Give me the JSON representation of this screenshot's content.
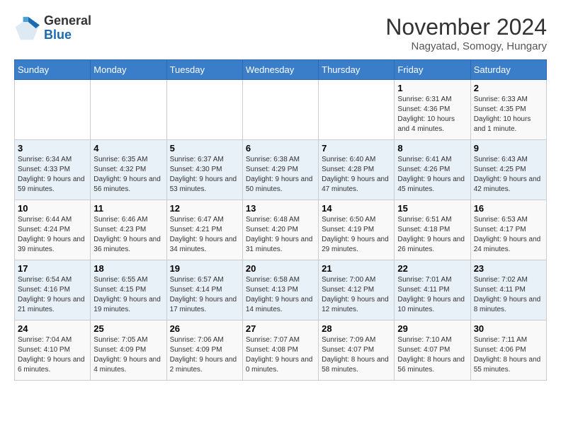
{
  "header": {
    "logo_general": "General",
    "logo_blue": "Blue",
    "month_title": "November 2024",
    "subtitle": "Nagyatad, Somogy, Hungary"
  },
  "weekdays": [
    "Sunday",
    "Monday",
    "Tuesday",
    "Wednesday",
    "Thursday",
    "Friday",
    "Saturday"
  ],
  "weeks": [
    [
      {
        "day": "",
        "info": ""
      },
      {
        "day": "",
        "info": ""
      },
      {
        "day": "",
        "info": ""
      },
      {
        "day": "",
        "info": ""
      },
      {
        "day": "",
        "info": ""
      },
      {
        "day": "1",
        "info": "Sunrise: 6:31 AM\nSunset: 4:36 PM\nDaylight: 10 hours and 4 minutes."
      },
      {
        "day": "2",
        "info": "Sunrise: 6:33 AM\nSunset: 4:35 PM\nDaylight: 10 hours and 1 minute."
      }
    ],
    [
      {
        "day": "3",
        "info": "Sunrise: 6:34 AM\nSunset: 4:33 PM\nDaylight: 9 hours and 59 minutes."
      },
      {
        "day": "4",
        "info": "Sunrise: 6:35 AM\nSunset: 4:32 PM\nDaylight: 9 hours and 56 minutes."
      },
      {
        "day": "5",
        "info": "Sunrise: 6:37 AM\nSunset: 4:30 PM\nDaylight: 9 hours and 53 minutes."
      },
      {
        "day": "6",
        "info": "Sunrise: 6:38 AM\nSunset: 4:29 PM\nDaylight: 9 hours and 50 minutes."
      },
      {
        "day": "7",
        "info": "Sunrise: 6:40 AM\nSunset: 4:28 PM\nDaylight: 9 hours and 47 minutes."
      },
      {
        "day": "8",
        "info": "Sunrise: 6:41 AM\nSunset: 4:26 PM\nDaylight: 9 hours and 45 minutes."
      },
      {
        "day": "9",
        "info": "Sunrise: 6:43 AM\nSunset: 4:25 PM\nDaylight: 9 hours and 42 minutes."
      }
    ],
    [
      {
        "day": "10",
        "info": "Sunrise: 6:44 AM\nSunset: 4:24 PM\nDaylight: 9 hours and 39 minutes."
      },
      {
        "day": "11",
        "info": "Sunrise: 6:46 AM\nSunset: 4:23 PM\nDaylight: 9 hours and 36 minutes."
      },
      {
        "day": "12",
        "info": "Sunrise: 6:47 AM\nSunset: 4:21 PM\nDaylight: 9 hours and 34 minutes."
      },
      {
        "day": "13",
        "info": "Sunrise: 6:48 AM\nSunset: 4:20 PM\nDaylight: 9 hours and 31 minutes."
      },
      {
        "day": "14",
        "info": "Sunrise: 6:50 AM\nSunset: 4:19 PM\nDaylight: 9 hours and 29 minutes."
      },
      {
        "day": "15",
        "info": "Sunrise: 6:51 AM\nSunset: 4:18 PM\nDaylight: 9 hours and 26 minutes."
      },
      {
        "day": "16",
        "info": "Sunrise: 6:53 AM\nSunset: 4:17 PM\nDaylight: 9 hours and 24 minutes."
      }
    ],
    [
      {
        "day": "17",
        "info": "Sunrise: 6:54 AM\nSunset: 4:16 PM\nDaylight: 9 hours and 21 minutes."
      },
      {
        "day": "18",
        "info": "Sunrise: 6:55 AM\nSunset: 4:15 PM\nDaylight: 9 hours and 19 minutes."
      },
      {
        "day": "19",
        "info": "Sunrise: 6:57 AM\nSunset: 4:14 PM\nDaylight: 9 hours and 17 minutes."
      },
      {
        "day": "20",
        "info": "Sunrise: 6:58 AM\nSunset: 4:13 PM\nDaylight: 9 hours and 14 minutes."
      },
      {
        "day": "21",
        "info": "Sunrise: 7:00 AM\nSunset: 4:12 PM\nDaylight: 9 hours and 12 minutes."
      },
      {
        "day": "22",
        "info": "Sunrise: 7:01 AM\nSunset: 4:11 PM\nDaylight: 9 hours and 10 minutes."
      },
      {
        "day": "23",
        "info": "Sunrise: 7:02 AM\nSunset: 4:11 PM\nDaylight: 9 hours and 8 minutes."
      }
    ],
    [
      {
        "day": "24",
        "info": "Sunrise: 7:04 AM\nSunset: 4:10 PM\nDaylight: 9 hours and 6 minutes."
      },
      {
        "day": "25",
        "info": "Sunrise: 7:05 AM\nSunset: 4:09 PM\nDaylight: 9 hours and 4 minutes."
      },
      {
        "day": "26",
        "info": "Sunrise: 7:06 AM\nSunset: 4:09 PM\nDaylight: 9 hours and 2 minutes."
      },
      {
        "day": "27",
        "info": "Sunrise: 7:07 AM\nSunset: 4:08 PM\nDaylight: 9 hours and 0 minutes."
      },
      {
        "day": "28",
        "info": "Sunrise: 7:09 AM\nSunset: 4:07 PM\nDaylight: 8 hours and 58 minutes."
      },
      {
        "day": "29",
        "info": "Sunrise: 7:10 AM\nSunset: 4:07 PM\nDaylight: 8 hours and 56 minutes."
      },
      {
        "day": "30",
        "info": "Sunrise: 7:11 AM\nSunset: 4:06 PM\nDaylight: 8 hours and 55 minutes."
      }
    ]
  ]
}
